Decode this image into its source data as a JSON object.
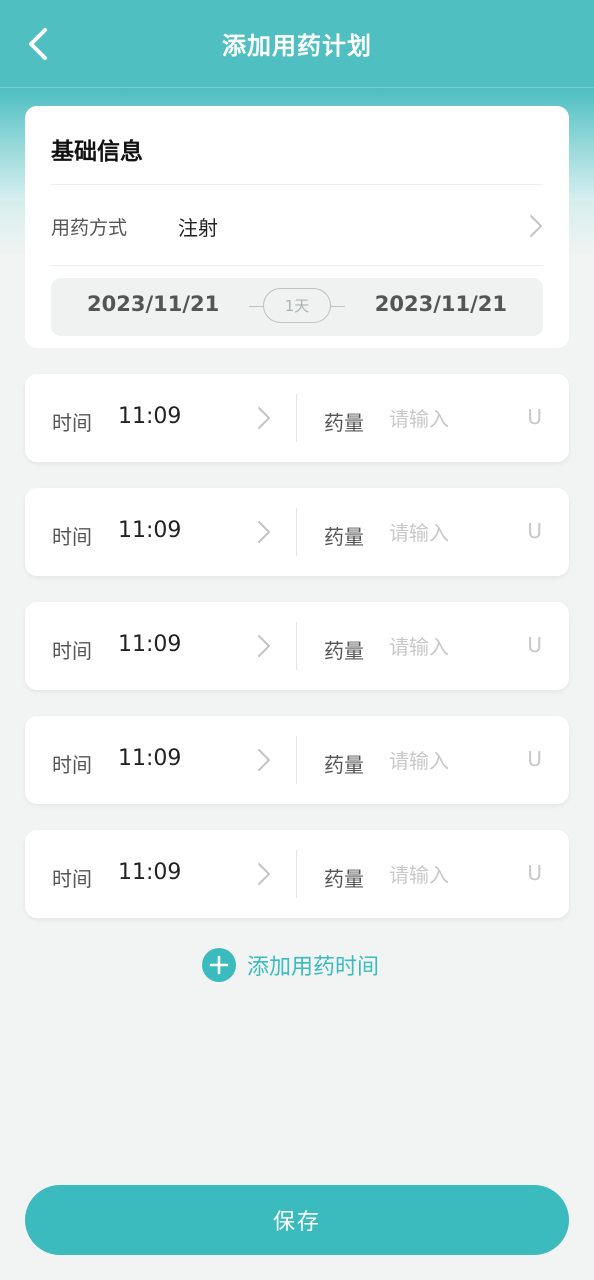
{
  "header": {
    "title": "添加用药计划",
    "back_icon": "chevron-left-icon"
  },
  "basic_info": {
    "title": "基础信息",
    "method_label": "用药方式",
    "method_value": "注射",
    "start_date": "2023/11/21",
    "end_date": "2023/11/21",
    "days": "1天"
  },
  "schedule": [
    {
      "time_label": "时间",
      "time_value": "11:09",
      "dose_label": "药量",
      "dose_placeholder": "请输入",
      "unit": "U"
    },
    {
      "time_label": "时间",
      "time_value": "11:09",
      "dose_label": "药量",
      "dose_placeholder": "请输入",
      "unit": "U"
    },
    {
      "time_label": "时间",
      "time_value": "11:09",
      "dose_label": "药量",
      "dose_placeholder": "请输入",
      "unit": "U"
    },
    {
      "time_label": "时间",
      "time_value": "11:09",
      "dose_label": "药量",
      "dose_placeholder": "请输入",
      "unit": "U"
    },
    {
      "time_label": "时间",
      "time_value": "11:09",
      "dose_label": "药量",
      "dose_placeholder": "请输入",
      "unit": "U"
    }
  ],
  "add_time_label": "添加用药时间",
  "save_label": "保存",
  "colors": {
    "accent": "#3bbbbd",
    "header": "#4fbfc2",
    "background": "#f2f4f3"
  }
}
